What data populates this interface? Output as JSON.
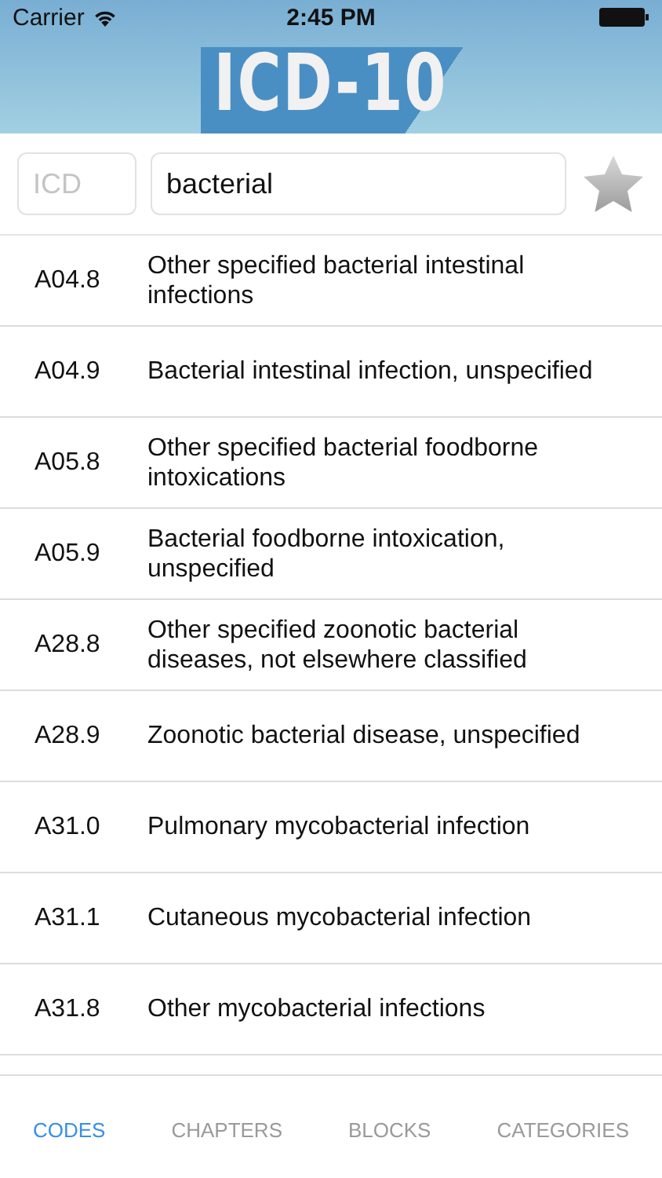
{
  "status_bar": {
    "carrier": "Carrier",
    "time": "2:45 PM"
  },
  "header": {
    "logo": "ICD-10"
  },
  "search": {
    "code_placeholder": "ICD",
    "query": "bacterial",
    "favorite": false
  },
  "results": [
    {
      "code": "A04.8",
      "description": "Other specified bacterial intestinal infections"
    },
    {
      "code": "A04.9",
      "description": "Bacterial intestinal infection, unspecified"
    },
    {
      "code": "A05.8",
      "description": "Other specified bacterial foodborne intoxications"
    },
    {
      "code": "A05.9",
      "description": "Bacterial foodborne intoxication, unspecified"
    },
    {
      "code": "A28.8",
      "description": "Other specified zoonotic bacterial diseases, not elsewhere classified"
    },
    {
      "code": "A28.9",
      "description": "Zoonotic bacterial disease, unspecified"
    },
    {
      "code": "A31.0",
      "description": "Pulmonary mycobacterial infection"
    },
    {
      "code": "A31.1",
      "description": "Cutaneous mycobacterial infection"
    },
    {
      "code": "A31.8",
      "description": "Other mycobacterial infections"
    }
  ],
  "tabs": [
    {
      "label": "CODES",
      "selected": true
    },
    {
      "label": "CHAPTERS",
      "selected": false
    },
    {
      "label": "BLOCKS",
      "selected": false
    },
    {
      "label": "CATEGORIES",
      "selected": false
    }
  ]
}
